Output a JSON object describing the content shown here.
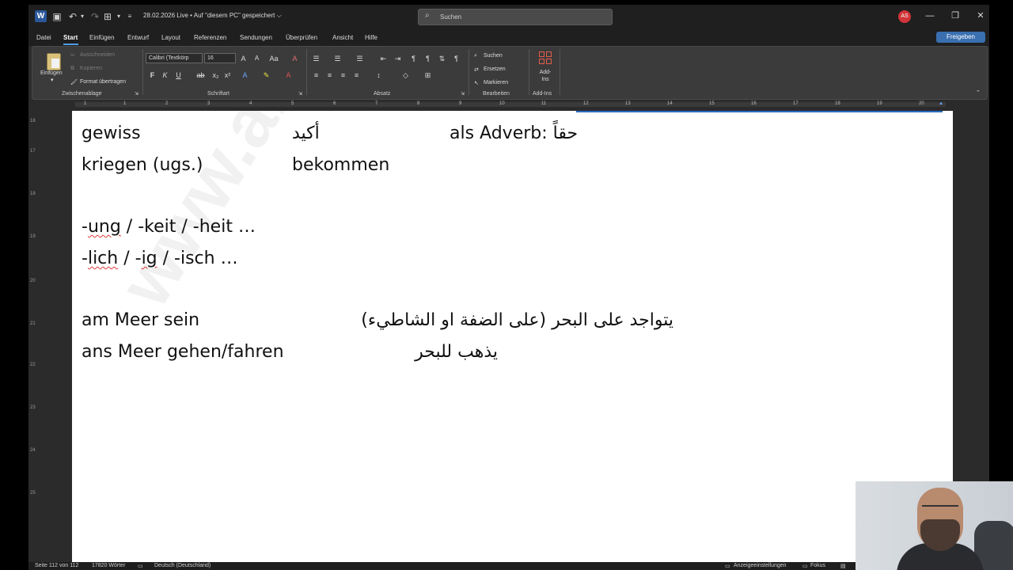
{
  "titlebar": {
    "title": "28.02.2026 Live • Auf \"diesem PC\" gespeichert ⌵",
    "search_placeholder": "Suchen",
    "user_initials": "AS"
  },
  "menu": {
    "tabs": [
      "Datei",
      "Start",
      "Einfügen",
      "Entwurf",
      "Layout",
      "Referenzen",
      "Sendungen",
      "Überprüfen",
      "Ansicht",
      "Hilfe"
    ],
    "active_tab": "Start",
    "share_label": "Freigeben"
  },
  "ribbon": {
    "clipboard": {
      "paste": "Einfügen",
      "cut": "Ausschneiden",
      "copy": "Kopieren",
      "format_painter": "Format übertragen",
      "label": "Zwischenablage"
    },
    "font": {
      "font_name": "Calibri (Textkörp",
      "font_size": "16",
      "label": "Schriftart"
    },
    "paragraph": {
      "label": "Absatz"
    },
    "editing": {
      "find": "Suchen",
      "replace": "Ersetzen",
      "select": "Markieren",
      "label": "Bearbeiten"
    },
    "addins": {
      "button": "Add-Ins",
      "label": "Add-Ins"
    }
  },
  "ruler": {
    "numbers": [
      "1",
      "1",
      "2",
      "3",
      "4",
      "5",
      "6",
      "7",
      "8",
      "9",
      "10",
      "11",
      "12",
      "13",
      "14",
      "15",
      "16",
      "17",
      "18",
      "19",
      "20"
    ],
    "vnumbers": [
      "18",
      "17",
      "18",
      "19",
      "20",
      "21",
      "22",
      "23",
      "24",
      "25"
    ]
  },
  "document": {
    "watermark": "www.ahme",
    "lines": {
      "l1a": "gewiss",
      "l1b": "أكيد",
      "l1c": "als Adverb: حقاً",
      "l2a": "kriegen (ugs.)",
      "l2b": "bekommen",
      "l3_pre1": "-",
      "l3_w1": "ung",
      "l3_mid1": " / -",
      "l3_w2": "keit",
      "l3_mid2": " / -",
      "l3_w3": "heit",
      "l3_end": " …",
      "l4_pre1": "-",
      "l4_w1": "lich",
      "l4_mid1": " / -",
      "l4_w2": "ig",
      "l4_mid2": " / -",
      "l4_w3": "isch",
      "l4_end": " …",
      "l5a": "am Meer sein",
      "l5b": "يتواجد على البحر (على الضفة او الشاطيء)",
      "l6a": "ans Meer gehen/fahren",
      "l6b": "يذهب للبحر"
    }
  },
  "statusbar": {
    "page": "Seite 112 von 112",
    "words": "17820 Wörter",
    "language": "Deutsch (Deutschland)",
    "display_settings": "Anzeigeeinstellungen",
    "focus": "Fokus"
  },
  "colors": {
    "accent": "#4f9fe8",
    "word_blue": "#2b579a",
    "spell_error": "#e23b3b",
    "avatar_red": "#d13438"
  }
}
